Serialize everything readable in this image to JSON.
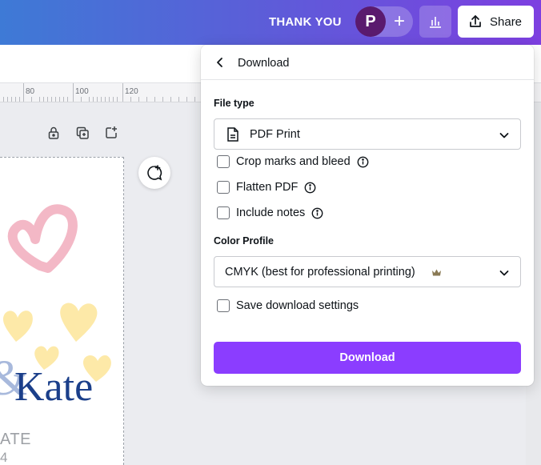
{
  "header": {
    "doc_title": "THANK YOU",
    "avatar_initial": "P",
    "add_label": "+",
    "share_label": "Share"
  },
  "ruler": {
    "labels": [
      "80",
      "100",
      "120"
    ]
  },
  "design": {
    "name_text": "Kate",
    "amp_text": "&",
    "subtext": "ATE",
    "subtext2": "4"
  },
  "download_panel": {
    "title": "Download",
    "file_type": {
      "label": "File type",
      "selected": "PDF Print",
      "icon": "document-icon"
    },
    "options": [
      {
        "label": "Crop marks and bleed",
        "checked": false,
        "has_info": true
      },
      {
        "label": "Flatten PDF",
        "checked": false,
        "has_info": true
      },
      {
        "label": "Include notes",
        "checked": false,
        "has_info": true
      }
    ],
    "color_profile": {
      "label": "Color Profile",
      "selected": "CMYK (best for professional printing)",
      "badge_icon": "crown-icon"
    },
    "save_settings": {
      "label": "Save download settings",
      "checked": false
    },
    "download_label": "Download"
  },
  "colors": {
    "accent": "#8b3dff",
    "avatar": "#5a1a6e",
    "heart_pink": "#f3b8c6",
    "heart_yellow": "#fde9a8",
    "name_blue": "#1b3f8a"
  }
}
